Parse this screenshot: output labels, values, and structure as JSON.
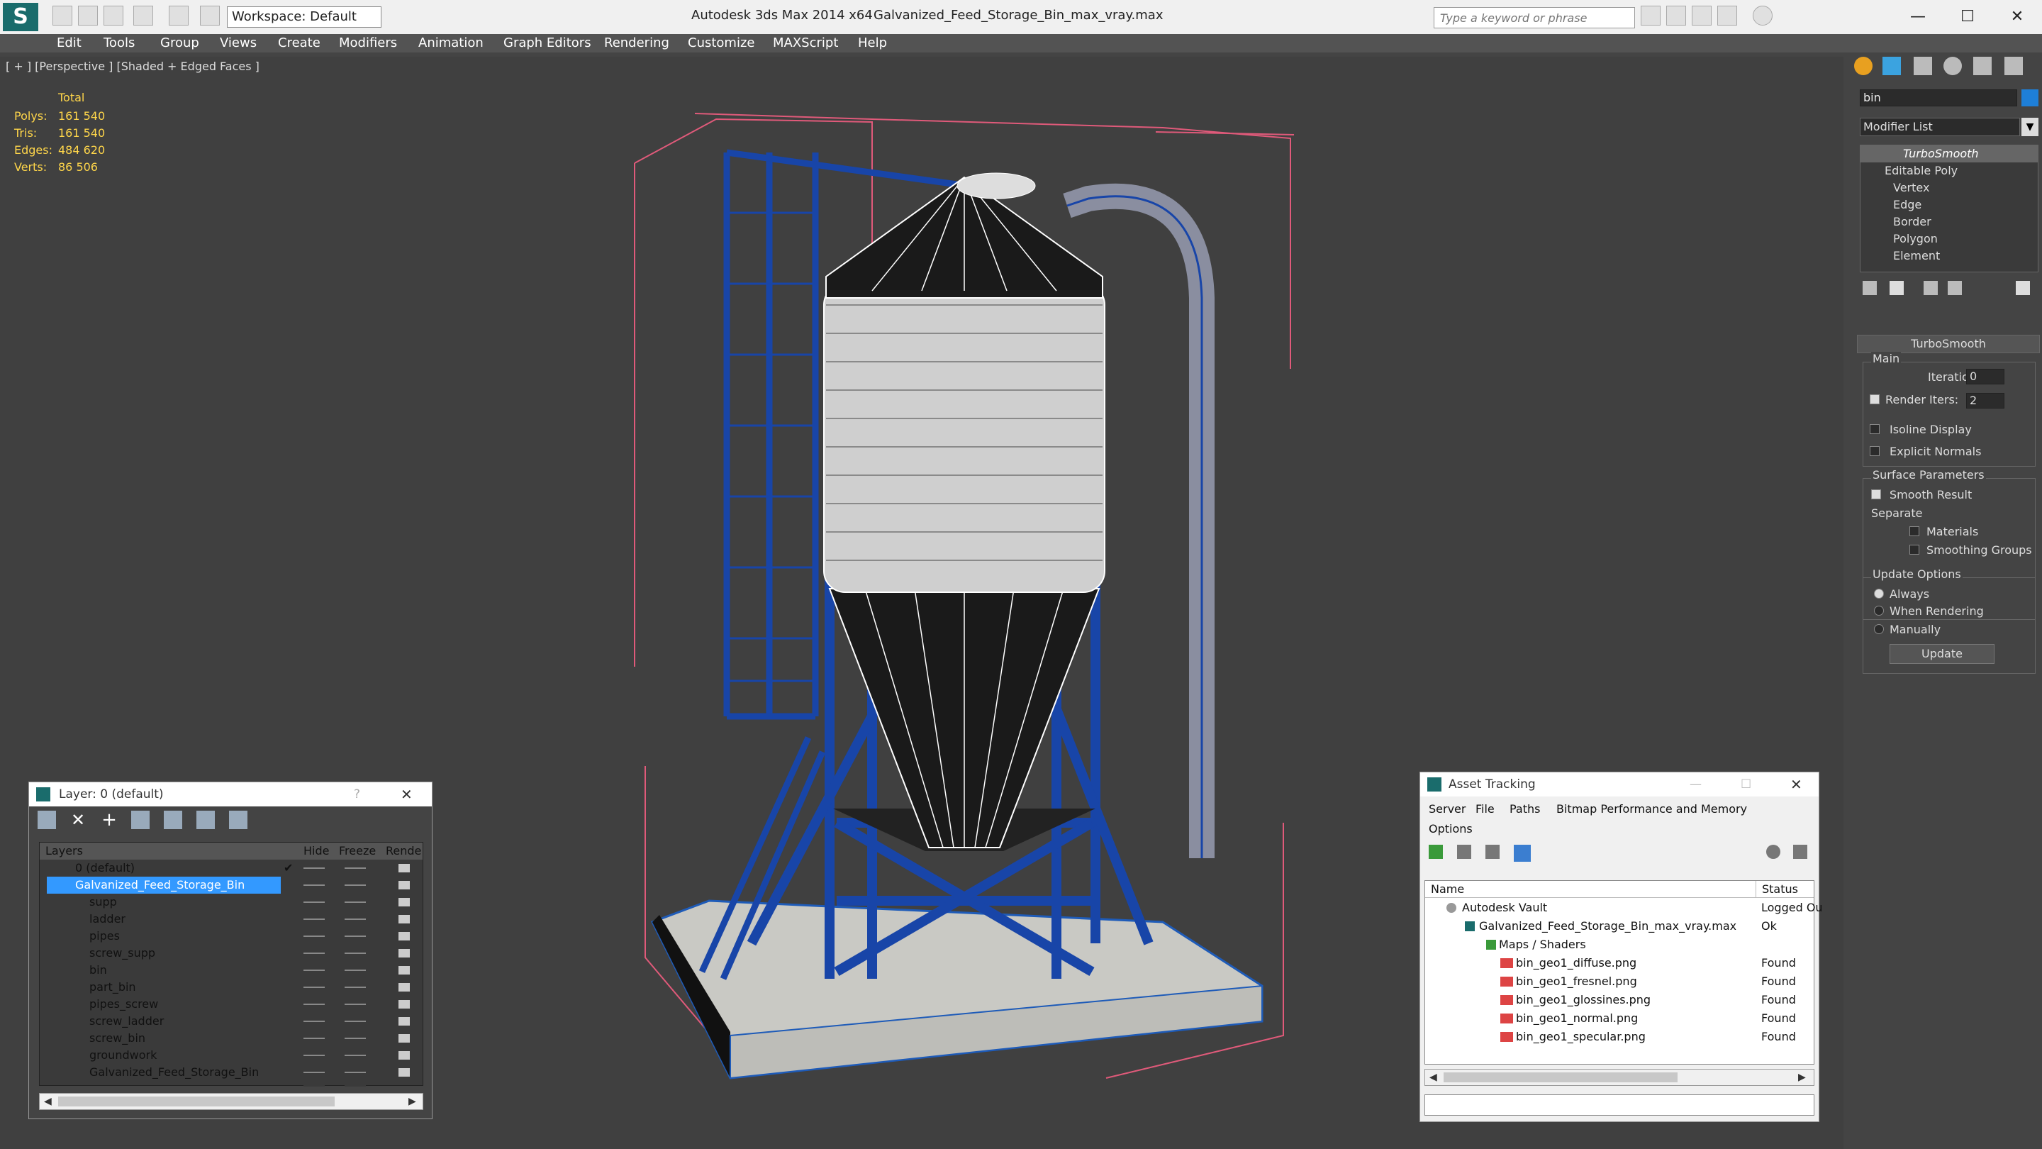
{
  "app": {
    "title": "Autodesk 3ds Max  2014 x64",
    "file": "Galvanized_Feed_Storage_Bin_max_vray.max",
    "workspace": "Workspace: Default",
    "search_placeholder": "Type a keyword or phrase"
  },
  "menu": [
    "Edit",
    "Tools",
    "Group",
    "Views",
    "Create",
    "Modifiers",
    "Animation",
    "Graph Editors",
    "Rendering",
    "Customize",
    "MAXScript",
    "Help"
  ],
  "viewport": {
    "label": "[ + ] [Perspective ] [Shaded + Edged Faces ]",
    "stats_header": "Total",
    "stats": [
      {
        "k": "Polys:",
        "v": "161 540"
      },
      {
        "k": "Tris:",
        "v": "161 540"
      },
      {
        "k": "Edges:",
        "v": "484 620"
      },
      {
        "k": "Verts:",
        "v": "86 506"
      }
    ]
  },
  "modify": {
    "name": "bin",
    "color": "#1e7fd8",
    "modifier_list": "Modifier List",
    "stack": [
      "TurboSmooth",
      "Editable Poly",
      "Vertex",
      "Edge",
      "Border",
      "Polygon",
      "Element"
    ],
    "rollout": "TurboSmooth",
    "main": "Main",
    "iterations_label": "Iterations:",
    "iterations": "0",
    "render_iters_label": "Render Iters:",
    "render_iters": "2",
    "isoline": "Isoline Display",
    "explicit": "Explicit Normals",
    "surface": "Surface Parameters",
    "smooth": "Smooth Result",
    "separate": "Separate",
    "materials": "Materials",
    "smoothing": "Smoothing Groups",
    "update_options": "Update Options",
    "always": "Always",
    "when_rendering": "When Rendering",
    "manually": "Manually",
    "update": "Update"
  },
  "layer": {
    "title": "Layer: 0 (default)",
    "help": "?",
    "cols": [
      "Layers",
      "Hide",
      "Freeze",
      "Rende"
    ],
    "rows": [
      "0 (default)",
      "Galvanized_Feed_Storage_Bin",
      "supp",
      "ladder",
      "pipes",
      "screw_supp",
      "bin",
      "part_bin",
      "pipes_screw",
      "screw_ladder",
      "screw_bin",
      "groundwork",
      "Galvanized_Feed_Storage_Bin"
    ]
  },
  "asset": {
    "title": "Asset Tracking",
    "menu": [
      "Server",
      "File",
      "Paths",
      "Bitmap Performance and Memory"
    ],
    "options": "Options",
    "cols": [
      "Name",
      "Status"
    ],
    "rows": [
      {
        "n": "Autodesk Vault",
        "s": "Logged Ou"
      },
      {
        "n": "Galvanized_Feed_Storage_Bin_max_vray.max",
        "s": "Ok"
      },
      {
        "n": "Maps / Shaders",
        "s": ""
      },
      {
        "n": "bin_geo1_diffuse.png",
        "s": "Found"
      },
      {
        "n": "bin_geo1_fresnel.png",
        "s": "Found"
      },
      {
        "n": "bin_geo1_glossines.png",
        "s": "Found"
      },
      {
        "n": "bin_geo1_normal.png",
        "s": "Found"
      },
      {
        "n": "bin_geo1_specular.png",
        "s": "Found"
      }
    ]
  }
}
